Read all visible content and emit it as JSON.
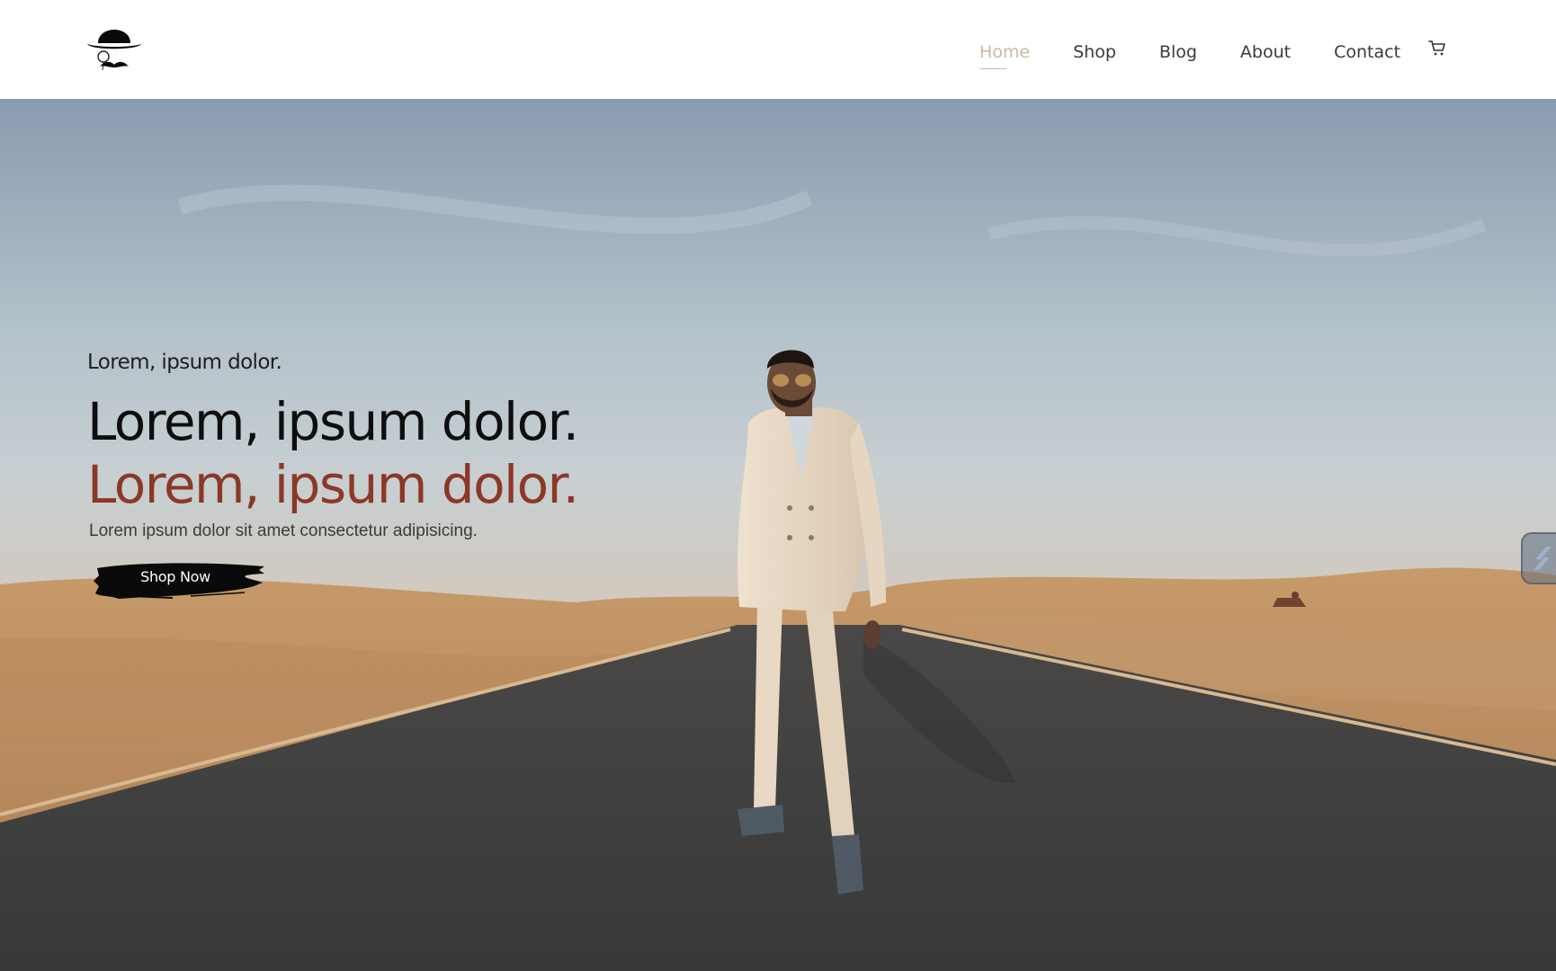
{
  "brand": {
    "logo_icon": "bowler-hat-mustache-logo"
  },
  "nav": {
    "items": [
      {
        "label": "Home",
        "active": true
      },
      {
        "label": "Shop",
        "active": false
      },
      {
        "label": "Blog",
        "active": false
      },
      {
        "label": "About",
        "active": false
      },
      {
        "label": "Contact",
        "active": false
      }
    ],
    "cart_icon": "cart-icon"
  },
  "hero": {
    "eyebrow": "Lorem, ipsum dolor.",
    "headline": "Lorem, ipsum dolor.",
    "headline_accent": "Lorem, ipsum dolor.",
    "subtext": "Lorem ipsum dolor sit amet consectetur adipisicing.",
    "cta_label": "Shop Now"
  },
  "colors": {
    "nav_active": "#c9b9a3",
    "nav_text": "#3a3a3a",
    "accent": "#8c3827",
    "cta_bg": "#0a0a0a"
  },
  "side_widget_icon": "floating-tool-icon"
}
